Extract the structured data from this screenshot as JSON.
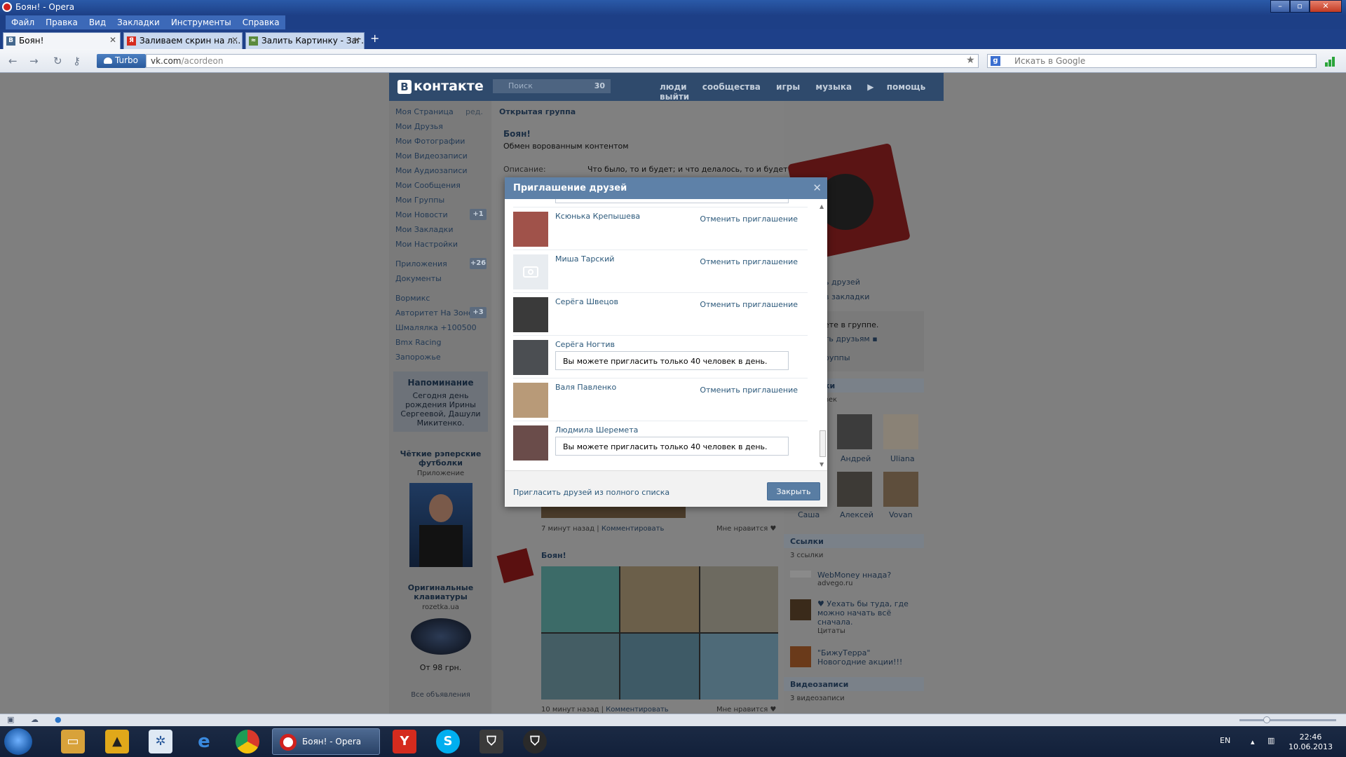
{
  "window": {
    "title": "Боян! - Opera"
  },
  "menu": [
    "Файл",
    "Правка",
    "Вид",
    "Закладки",
    "Инструменты",
    "Справка"
  ],
  "tabs": [
    {
      "title": "Боян!",
      "favicon": "В",
      "active": true
    },
    {
      "title": "Заливаем скрин на л...",
      "favicon": "Я",
      "active": false
    },
    {
      "title": "Залить Картинку - Заг...",
      "favicon": "≈",
      "active": false
    }
  ],
  "address": {
    "turbo": "Turbo",
    "host": "vk.com",
    "path": "/acordeon",
    "search_placeholder": "Искать в Google"
  },
  "vk": {
    "logo": "контакте",
    "search_placeholder": "Поиск",
    "search_count": "30",
    "nav": [
      "люди",
      "сообщества",
      "игры",
      "музыка",
      "помощь",
      "выйти"
    ]
  },
  "left_menu": {
    "items": [
      {
        "label": "Моя Страница",
        "extra": "ред."
      },
      {
        "label": "Мои Друзья"
      },
      {
        "label": "Мои Фотографии"
      },
      {
        "label": "Мои Видеозаписи"
      },
      {
        "label": "Мои Аудиозаписи"
      },
      {
        "label": "Мои Сообщения"
      },
      {
        "label": "Мои Группы"
      },
      {
        "label": "Мои Новости",
        "badge": "+1"
      },
      {
        "label": "Мои Закладки"
      },
      {
        "label": "Мои Настройки"
      }
    ],
    "apps": [
      {
        "label": "Приложения",
        "badge": "+26"
      },
      {
        "label": "Документы"
      }
    ],
    "games": [
      {
        "label": "Вормикс"
      },
      {
        "label": "Авторитет На Зоне",
        "badge": "+3"
      },
      {
        "label": "Шмалялка +100500"
      },
      {
        "label": "Bmx Racing"
      },
      {
        "label": "Запорожье"
      }
    ]
  },
  "reminder": {
    "title": "Напоминание",
    "text": "Сегодня день рождения Ирины Сергеевой, Дашули Микитенко."
  },
  "ads": [
    {
      "title": "Чёткие рэперские футболки",
      "sub": "Приложение"
    },
    {
      "title": "Оригинальные клавиатуры",
      "sub": "rozetka.ua",
      "price": "От 98 грн."
    }
  ],
  "all_ads": "Все объявления",
  "group": {
    "type": "Открытая группа",
    "name": "Боян!",
    "status": "Обмен ворованным контентом",
    "desc_label": "Описание:",
    "desc": "Что было, то и будет; и что делалось, то и будет"
  },
  "posts": [
    {
      "time": "7 минут назад",
      "comment": "Комментировать",
      "like": "Мне нравится"
    },
    {
      "author": "Боян!",
      "time": "10 минут назад",
      "comment": "Комментировать",
      "like": "Мне нравится"
    }
  ],
  "right": {
    "friends_link": "ь друзей",
    "bookmarks_link": "в закладки",
    "in_group": "ете в группе.",
    "tell_friends": "ть друзьям",
    "groups_link": "руппы",
    "members_header": "ки",
    "members_count": "век",
    "members": [
      "Андрей",
      "Uliana",
      "Саша",
      "Алексей",
      "Vovan"
    ],
    "links_header": "Ссылки",
    "links_count": "3 ссылки",
    "links": [
      {
        "title": "WebMoney ннада?",
        "sub": "advego.ru"
      },
      {
        "title": "♥ Уехать бы туда, где можно начать всё сначала.",
        "sub": "Цитаты"
      },
      {
        "title": "\"БижуТерра\" Новогодние акции!!!",
        "sub": ""
      }
    ],
    "video_header": "Видеозаписи",
    "video_count": "3 видеозаписи"
  },
  "dialog": {
    "title": "Приглашение друзей",
    "rows": [
      {
        "name": "Ксюнька Крепышева",
        "action": "Отменить приглашение",
        "avatar_color": "#a0524a"
      },
      {
        "name": "Миша Тарский",
        "action": "Отменить приглашение",
        "avatar_color": "#e8ecf0"
      },
      {
        "name": "Серёга Швецов",
        "action": "Отменить приглашение",
        "avatar_color": "#3a3a3a"
      },
      {
        "name": "Серёга Ногтив",
        "limit": "Вы можете пригласить только 40 человек в день.",
        "avatar_color": "#4b4e52"
      },
      {
        "name": "Валя Павленко",
        "action": "Отменить приглашение",
        "avatar_color": "#b89a78"
      },
      {
        "name": "Людмила Шеремета",
        "limit": "Вы можете пригласить только 40 человек в день.",
        "avatar_color": "#6a4c4a"
      }
    ],
    "invite_all": "Пригласить друзей из полного списка",
    "close": "Закрыть"
  },
  "taskbar": {
    "active_task": "Боян! - Opera",
    "lang": "EN",
    "time": "22:46",
    "date": "10.06.2013"
  }
}
